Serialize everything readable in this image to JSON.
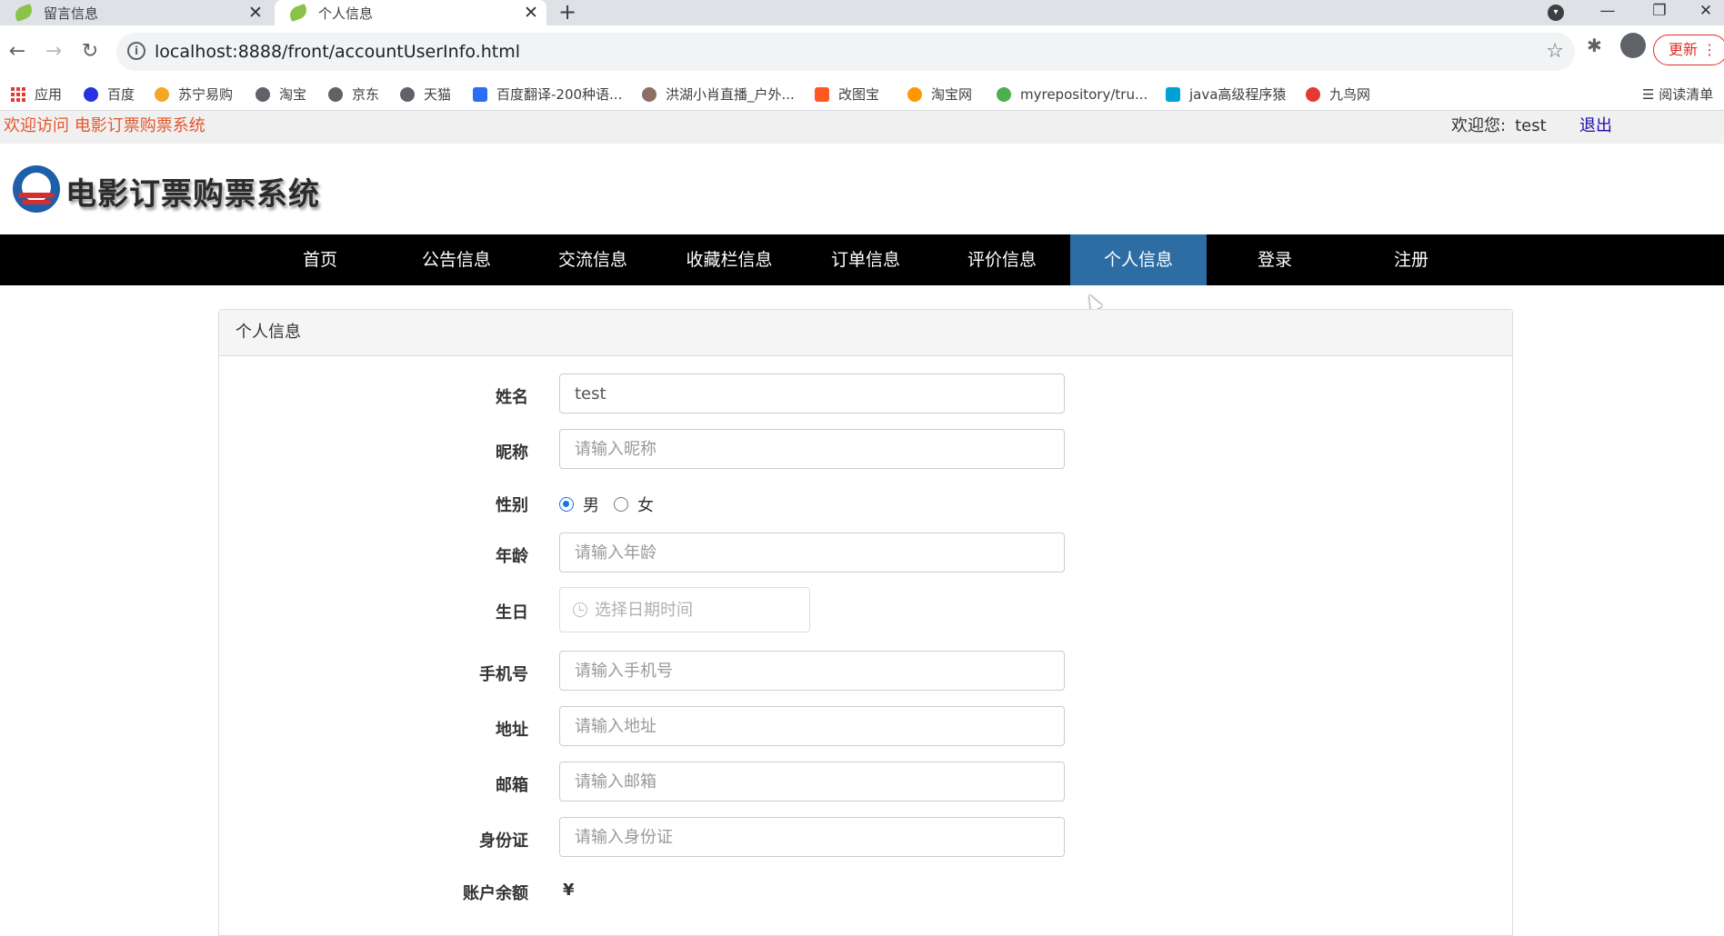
{
  "browser": {
    "tabs": [
      {
        "title": "留言信息",
        "active": false
      },
      {
        "title": "个人信息",
        "active": true
      }
    ],
    "new_tab": "+",
    "url": "localhost:8888/front/accountUserInfo.html",
    "update_label": "更新",
    "bookmarks": [
      "应用",
      "百度",
      "苏宁易购",
      "淘宝",
      "京东",
      "天猫",
      "百度翻译-200种语...",
      "洪湖小肖直播_户外...",
      "改图宝",
      "淘宝网",
      "myrepository/tru...",
      "java高级程序猿",
      "九鸟网"
    ],
    "reading_list": "阅读清单"
  },
  "site": {
    "welcome_text": "欢迎访问 电影订票购票系统",
    "greeting": "欢迎您:",
    "username": "test",
    "logout_label": "退出",
    "title": "电影订票购票系统",
    "nav": [
      "首页",
      "公告信息",
      "交流信息",
      "收藏栏信息",
      "订单信息",
      "评价信息",
      "个人信息",
      "登录",
      "注册"
    ],
    "nav_active": "个人信息",
    "accent_color": "#2e6da4",
    "welcome_color": "#e4572e"
  },
  "form": {
    "panel_title": "个人信息",
    "name": {
      "label": "姓名",
      "value": "test"
    },
    "nickname": {
      "label": "昵称",
      "placeholder": "请输入昵称"
    },
    "gender": {
      "label": "性别",
      "options": [
        "男",
        "女"
      ],
      "selected": "男"
    },
    "age": {
      "label": "年龄",
      "placeholder": "请输入年龄"
    },
    "birthday": {
      "label": "生日",
      "placeholder": "选择日期时间"
    },
    "phone": {
      "label": "手机号",
      "placeholder": "请输入手机号"
    },
    "address": {
      "label": "地址",
      "placeholder": "请输入地址"
    },
    "email": {
      "label": "邮箱",
      "placeholder": "请输入邮箱"
    },
    "id_card": {
      "label": "身份证",
      "placeholder": "请输入身份证"
    },
    "balance": {
      "label": "账户余额",
      "currency": "¥"
    }
  }
}
